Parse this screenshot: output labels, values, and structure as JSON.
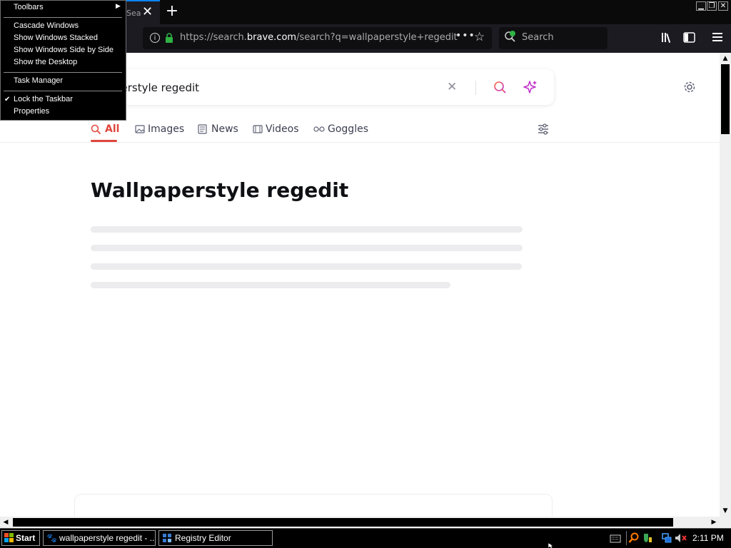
{
  "browser": {
    "tab": {
      "title": "Sea",
      "close": "✕"
    },
    "new_tab": "+",
    "window_controls": {
      "minimize": "▁",
      "restore": "❐",
      "close": "✕"
    },
    "url": {
      "prefix": "https://search.",
      "domain": "brave.com",
      "suffix": "/search?q=wallpaperstyle+regedit"
    },
    "url_more": "•••",
    "search_placeholder": "Search"
  },
  "page": {
    "query": "perstyle regedit",
    "tabs": [
      {
        "label": "All"
      },
      {
        "label": "Images"
      },
      {
        "label": "News"
      },
      {
        "label": "Videos"
      },
      {
        "label": "Goggles"
      }
    ],
    "heading": "Wallpaperstyle regedit"
  },
  "context_menu": {
    "items": [
      {
        "label": "Toolbars",
        "submenu": true
      },
      {
        "label": "Cascade Windows"
      },
      {
        "label": "Show Windows Stacked"
      },
      {
        "label": "Show Windows Side by Side"
      },
      {
        "label": "Show the Desktop"
      },
      {
        "label": "Task Manager"
      },
      {
        "label": "Lock the Taskbar",
        "checked": true
      },
      {
        "label": "Properties"
      }
    ]
  },
  "taskbar": {
    "start": "Start",
    "windows": [
      {
        "label": "wallpaperstyle regedit - ..."
      },
      {
        "label": "Registry Editor"
      }
    ],
    "clock": "2:11 PM"
  },
  "colors": {
    "accent": "#e0453a",
    "brave_purple": "#a02fc9",
    "lock_green": "#2fb344"
  }
}
